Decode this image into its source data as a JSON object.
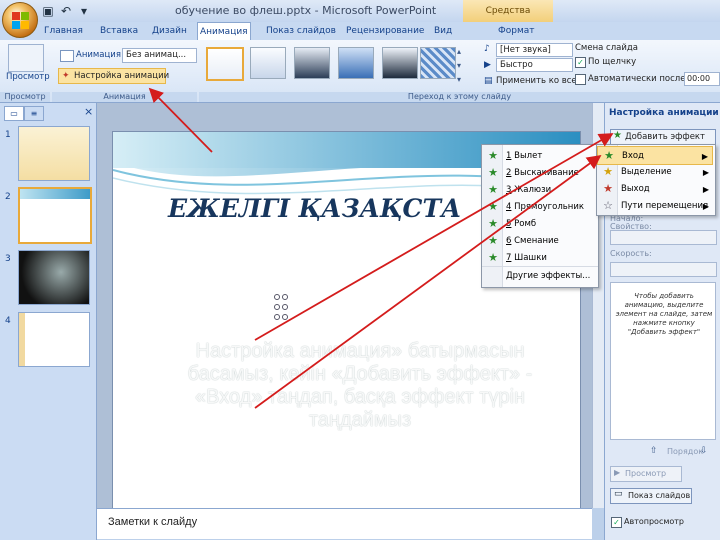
{
  "window": {
    "title": "обучение во флеш.pptx - Microsoft PowerPoint",
    "contextual_tab_group": "Средства рисования"
  },
  "tabs": [
    "Главная",
    "Вставка",
    "Дизайн",
    "Анимация",
    "Показ слайдов",
    "Рецензирование",
    "Вид",
    "Формат"
  ],
  "ribbon": {
    "preview_label": "Просмотр",
    "animation_label": "Анимация:",
    "animation_value": "Без анимац...",
    "custom_animation_button": "Настройка анимации",
    "groups": {
      "preview": "Просмотр",
      "animation": "Анимация",
      "transition": "Переход к этому слайду"
    },
    "sound_value": "[Нет звука]",
    "speed_value": "Быстро",
    "apply_all": "Применить ко всем",
    "change_slide": "Смена слайда",
    "on_click": "По щелчку",
    "auto_after": "Автоматически после:",
    "auto_time": "00:00"
  },
  "slide_pane": {
    "tab_slides": "",
    "close": "×",
    "slides": [
      "1",
      "2",
      "3",
      "4"
    ]
  },
  "slide": {
    "title": "ЕЖЕЛГІ    ҚАЗАҚСТА",
    "body": "Настройка анимация» батырмасын басамыз, кейін «Добавить эффект» - «Вход» таңдап, басқа эффект түрін таңдаймыз"
  },
  "notes_placeholder": "Заметки к слайду",
  "task_pane": {
    "title": "Настройка анимации",
    "add_effect": "Добавить эффект",
    "label_start": "Начало:",
    "label_property": "Свойство:",
    "label_speed": "Скорость:",
    "hint": "Чтобы добавить анимацию, выделите элемент на слайде, затем нажмите кнопку \"Добавить эффект\"",
    "order": "Порядок",
    "preview": "Просмотр",
    "slideshow": "Показ слайдов",
    "autopreview": "Автопросмотр"
  },
  "add_effect_menu": [
    {
      "icon": "star-green-icon",
      "label": "Вход"
    },
    {
      "icon": "star-yellow-icon",
      "label": "Выделение"
    },
    {
      "icon": "star-red-icon",
      "label": "Выход"
    },
    {
      "icon": "star-outline-icon",
      "label": "Пути перемещения"
    }
  ],
  "entrance_menu": [
    {
      "num": "1",
      "label": "Вылет"
    },
    {
      "num": "2",
      "label": "Выскакивание"
    },
    {
      "num": "3",
      "label": "Жалюзи"
    },
    {
      "num": "4",
      "label": "Прямоугольник"
    },
    {
      "num": "5",
      "label": "Ромб"
    },
    {
      "num": "6",
      "label": "Сменание"
    },
    {
      "num": "7",
      "label": "Шашки"
    },
    {
      "num": "",
      "label": "Другие эффекты..."
    }
  ],
  "colors": {
    "accent": "#15428b",
    "ribbon": "#d5e3f5",
    "highlight": "#fbe3a2",
    "arrow": "#d41c1c"
  }
}
